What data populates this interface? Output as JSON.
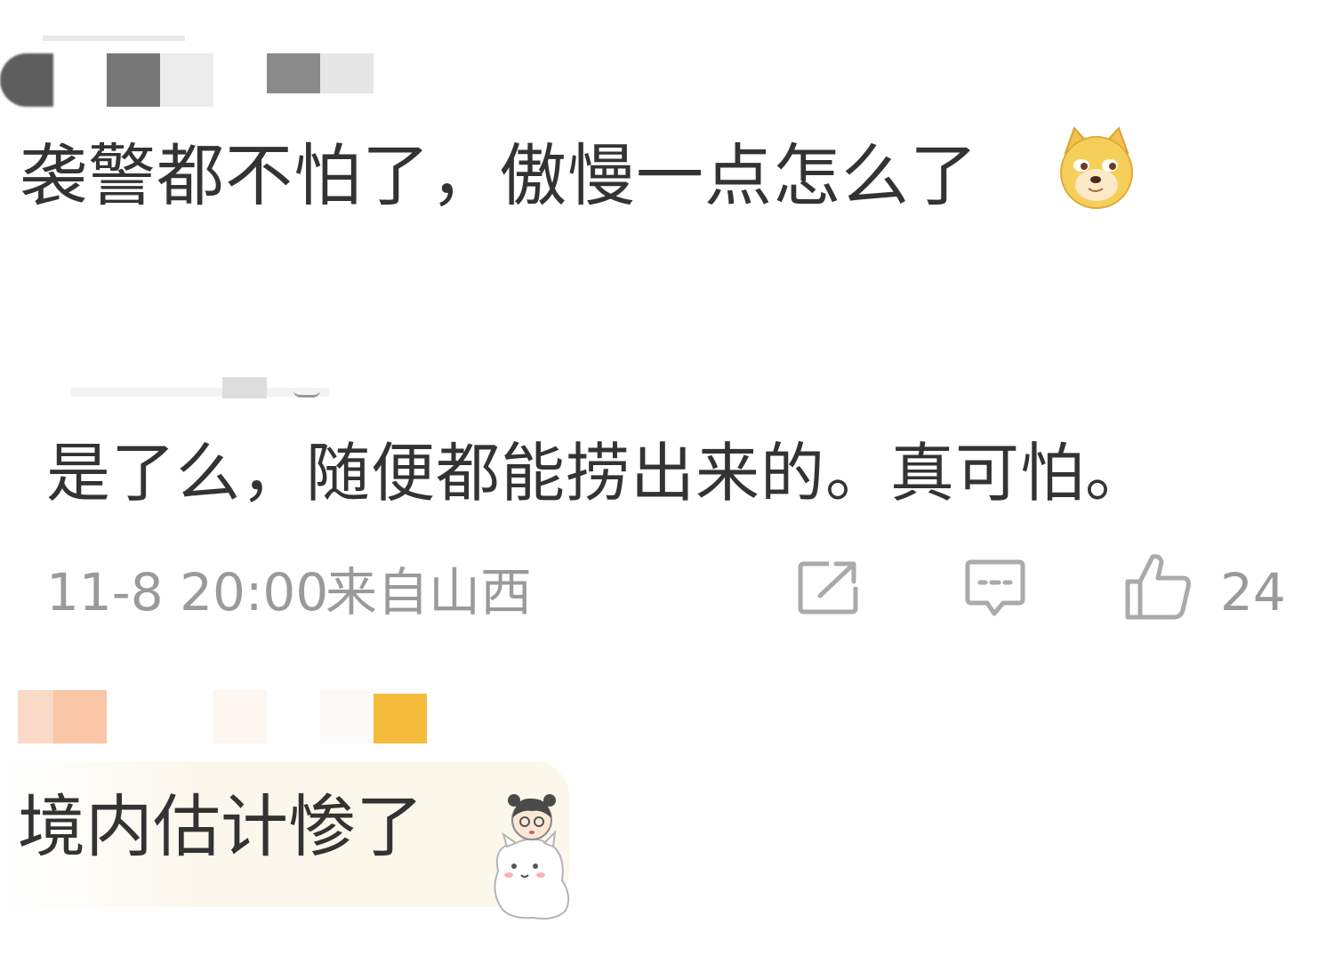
{
  "comments": [
    {
      "text": "袭警都不怕了，傲慢一点怎么了",
      "emoji": "doge-emoji"
    },
    {
      "text": "是了么，随便都能捞出来的。真可怕。",
      "time": "11-8 20:00",
      "location": "来自山西",
      "like_count": "24",
      "actions": [
        "share-icon",
        "comment-icon",
        "like-icon"
      ]
    },
    {
      "text": "境内估计惨了",
      "sticker": "girl-with-cat-sticker"
    }
  ],
  "colors": {
    "text": "#333333",
    "meta": "#9a9a9a",
    "bubble": "#fbf7ea",
    "icon": "#aaaaaa"
  }
}
